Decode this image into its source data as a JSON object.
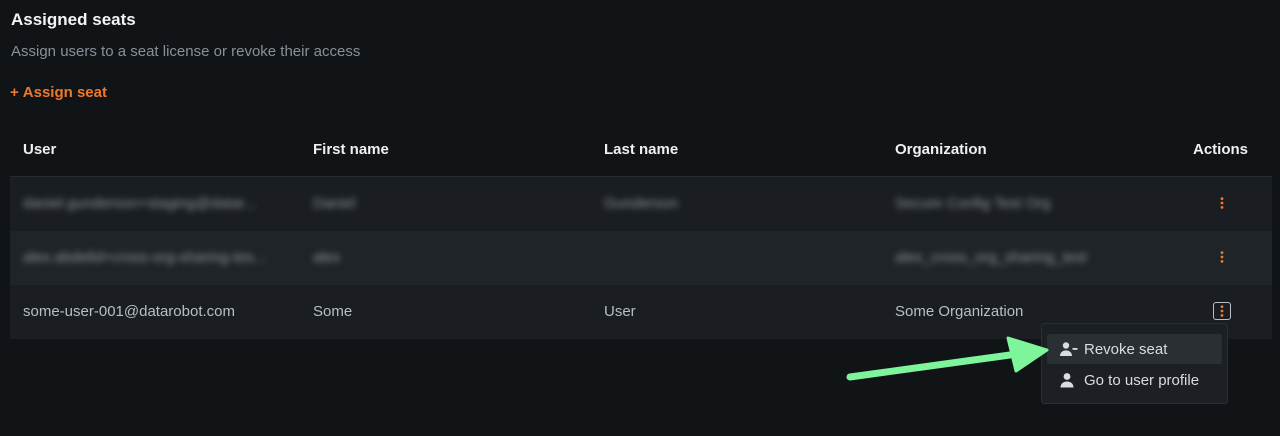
{
  "section": {
    "title": "Assigned seats",
    "subtitle": "Assign users to a seat license or revoke their access",
    "assign_plus": "+",
    "assign_label": "Assign seat"
  },
  "table": {
    "columns": [
      "User",
      "First name",
      "Last name",
      "Organization",
      "Actions"
    ],
    "rows": [
      {
        "user": "daniel.gunderson+staging@datar...",
        "first_name": "Daniel",
        "last_name": "Gunderson",
        "organization": "Secure Config Test Org",
        "blurred": true
      },
      {
        "user": "alex.abdelid+cross-org-sharing-tes...",
        "first_name": "alex",
        "last_name": "",
        "organization": "alex_cross_org_sharing_test",
        "blurred": true
      },
      {
        "user": "some-user-001@datarobot.com",
        "first_name": "Some",
        "last_name": "User",
        "organization": "Some Organization",
        "blurred": false
      }
    ]
  },
  "action_menu": {
    "items": [
      {
        "label": "Revoke seat",
        "icon": "user-minus-icon"
      },
      {
        "label": "Go to user profile",
        "icon": "user-icon"
      }
    ]
  },
  "colors": {
    "accent": "#f0782a",
    "background": "#111417",
    "pointer_arrow": "#7ef59a"
  }
}
